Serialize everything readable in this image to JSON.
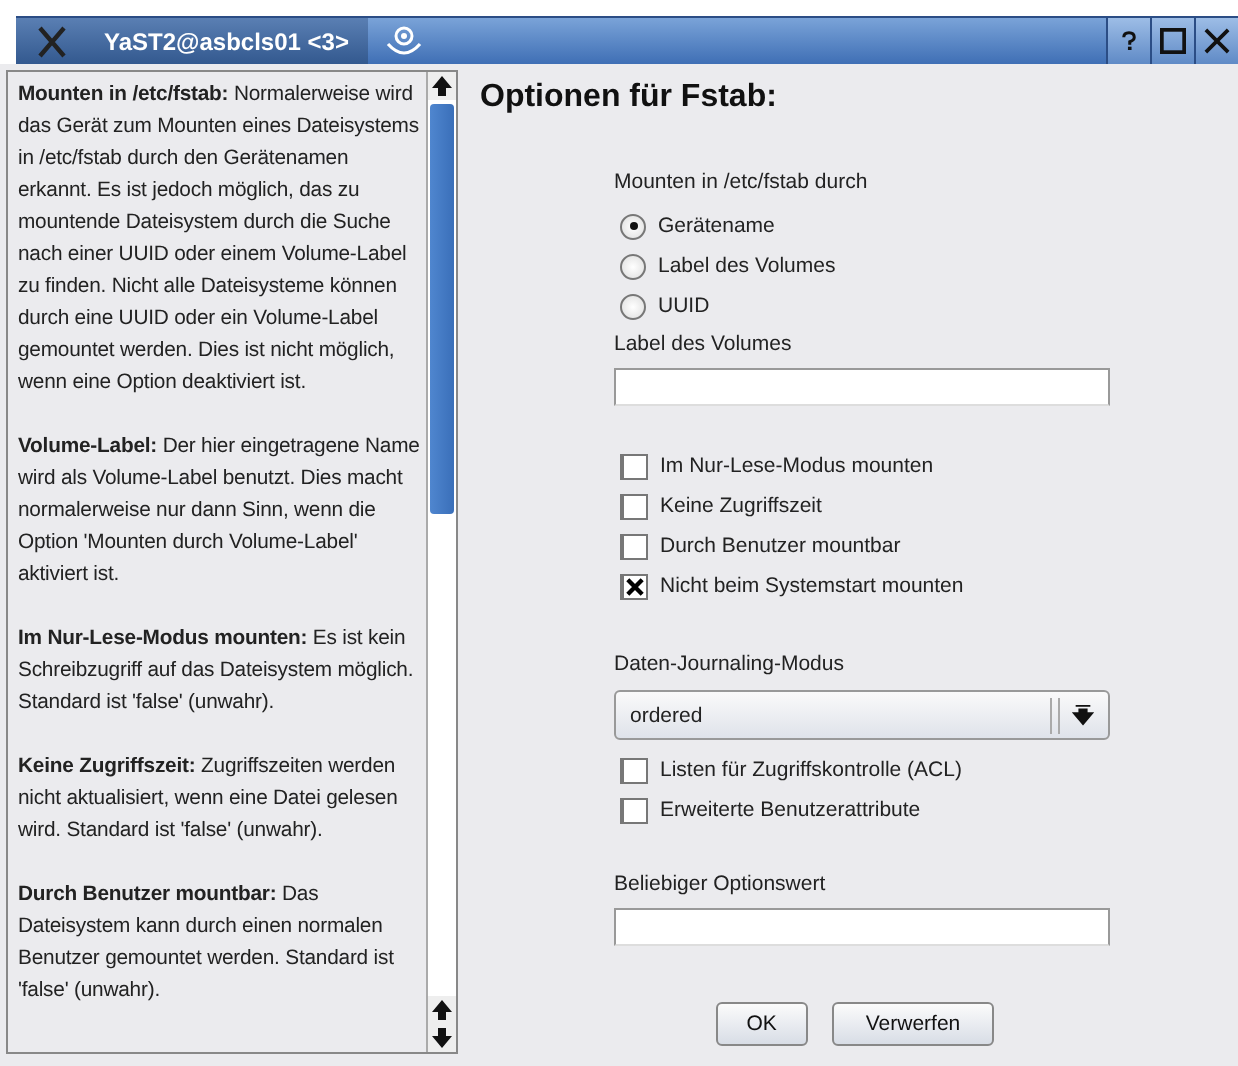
{
  "window": {
    "title": "YaST2@asbcls01 <3>"
  },
  "help": [
    "**Mounten in /etc/fstab:** Normalerweise wird das Gerät zum Mounten eines Dateisystems in /etc/fstab durch den Gerätenamen erkannt. Es ist jedoch möglich, das zu mountende Dateisystem durch die Suche nach einer UUID oder einem Volume-Label zu finden. Nicht alle Dateisysteme können durch eine UUID oder ein Volume-Label gemountet werden. Dies ist nicht möglich, wenn eine Option deaktiviert ist.",
    "**Volume-Label:** Der hier eingetragene Name wird als Volume-Label benutzt. Dies macht normalerweise nur dann Sinn, wenn die Option 'Mounten durch Volume-Label' aktiviert ist.",
    "**Im Nur-Lese-Modus mounten:** Es ist kein Schreibzugriff auf das Dateisystem möglich. Standard ist 'false' (unwahr).",
    "**Keine Zugriffszeit:** Zugriffszeiten werden nicht aktualisiert, wenn eine Datei gelesen wird. Standard ist 'false' (unwahr).",
    "**Durch Benutzer mountbar:** Das Dateisystem kann durch einen normalen Benutzer gemountet werden. Standard ist 'false' (unwahr)."
  ],
  "heading": "Optionen für Fstab:",
  "mount_by": {
    "label": "Mounten in /etc/fstab durch",
    "options": [
      {
        "label": "Gerätename",
        "selected": true
      },
      {
        "label": "Label des Volumes",
        "selected": false
      },
      {
        "label": "UUID",
        "selected": false
      }
    ]
  },
  "volume_label": {
    "label": "Label des Volumes"
  },
  "options": [
    {
      "label": "Im Nur-Lese-Modus mounten",
      "checked": false
    },
    {
      "label": "Keine Zugriffszeit",
      "checked": false
    },
    {
      "label": "Durch Benutzer mountbar",
      "checked": false
    },
    {
      "label": "Nicht beim Systemstart mounten",
      "checked": true
    }
  ],
  "journaling": {
    "label": "Daten-Journaling-Modus",
    "value": "ordered"
  },
  "attributes": [
    {
      "label": "Listen für Zugriffskontrolle (ACL)",
      "checked": false
    },
    {
      "label": "Erweiterte Benutzerattribute",
      "checked": false
    }
  ],
  "arbitrary": {
    "label": "Beliebiger Optionswert"
  },
  "buttons": [
    "OK",
    "Verwerfen"
  ]
}
